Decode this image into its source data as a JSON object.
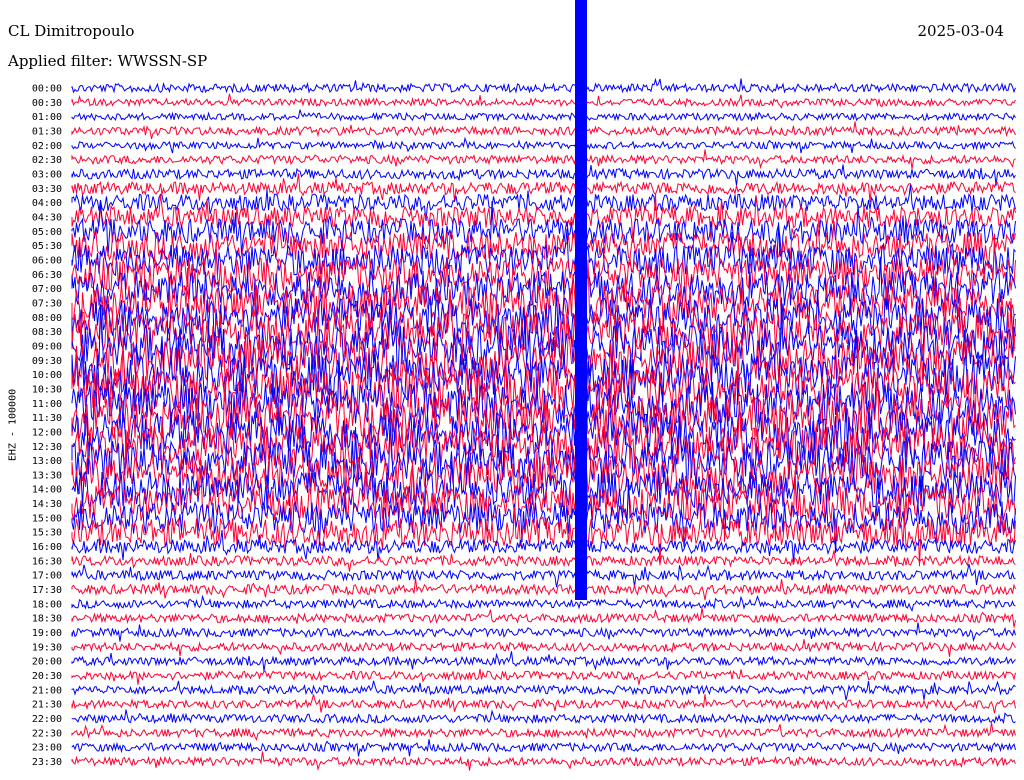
{
  "header": {
    "station": "CL Dimitropoulo",
    "filter": "Applied filter: WWSSN-SP",
    "date": "2025-03-04",
    "channel": "EHZ - 100000"
  },
  "colors": {
    "trace_a": "#0000ff",
    "trace_b": "#ff0033",
    "background": "#ffffff"
  },
  "chart_data": {
    "type": "line",
    "title": "CL Dimitropoulo",
    "ylabel": "EHZ - 100000",
    "row_labels": [
      "00:00",
      "00:30",
      "01:00",
      "01:30",
      "02:00",
      "02:30",
      "03:00",
      "03:30",
      "04:00",
      "04:30",
      "05:00",
      "05:30",
      "06:00",
      "06:30",
      "07:00",
      "07:30",
      "08:00",
      "08:30",
      "09:00",
      "09:30",
      "10:00",
      "10:30",
      "11:00",
      "11:30",
      "12:00",
      "12:30",
      "13:00",
      "13:30",
      "14:00",
      "14:30",
      "15:00",
      "15:30",
      "16:00",
      "16:30",
      "17:00",
      "17:30",
      "18:00",
      "18:30",
      "19:00",
      "19:30",
      "20:00",
      "20:30",
      "21:00",
      "21:30",
      "22:00",
      "22:30",
      "23:00",
      "23:30"
    ],
    "row_colors": [
      "trace_a",
      "trace_b",
      "trace_a",
      "trace_b",
      "trace_a",
      "trace_b",
      "trace_a",
      "trace_b",
      "trace_a",
      "trace_b",
      "trace_a",
      "trace_b",
      "trace_a",
      "trace_b",
      "trace_a",
      "trace_b",
      "trace_a",
      "trace_b",
      "trace_a",
      "trace_b",
      "trace_a",
      "trace_b",
      "trace_a",
      "trace_b",
      "trace_a",
      "trace_b",
      "trace_a",
      "trace_b",
      "trace_a",
      "trace_b",
      "trace_a",
      "trace_b",
      "trace_a",
      "trace_b",
      "trace_a",
      "trace_b",
      "trace_a",
      "trace_b",
      "trace_a",
      "trace_b",
      "trace_a",
      "trace_b",
      "trace_a",
      "trace_b",
      "trace_a",
      "trace_b",
      "trace_a",
      "trace_b"
    ],
    "row_amplitude": [
      0.6,
      0.5,
      0.5,
      0.6,
      0.5,
      0.6,
      0.7,
      0.9,
      1.2,
      1.5,
      1.8,
      2.0,
      2.2,
      2.4,
      2.5,
      2.6,
      2.7,
      2.8,
      2.9,
      3.0,
      3.0,
      3.0,
      3.0,
      3.0,
      3.0,
      2.9,
      2.8,
      2.7,
      2.6,
      2.5,
      2.3,
      2.0,
      1.0,
      0.7,
      0.7,
      0.7,
      0.6,
      0.6,
      0.6,
      0.6,
      0.6,
      0.6,
      0.6,
      0.6,
      0.6,
      0.6,
      0.6,
      0.6
    ],
    "minutes_per_row": 30
  }
}
